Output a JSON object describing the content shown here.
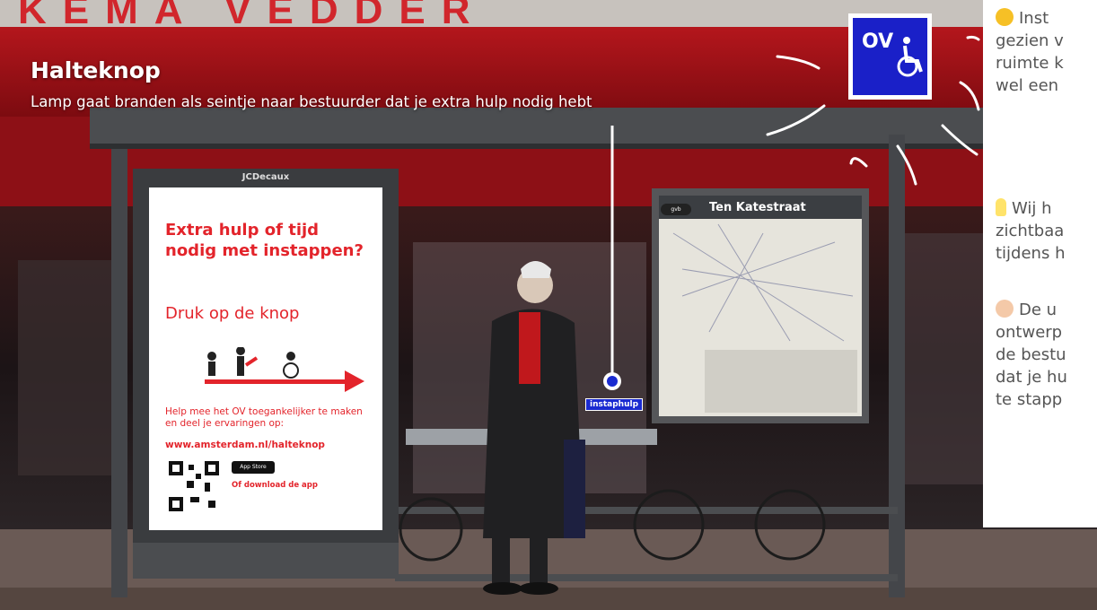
{
  "scene": {
    "heading": "Halteknop",
    "subheading": "Lamp gaat branden als seintje naar bestuurder dat je extra hulp nodig hebt",
    "pointer_label": "instaphulp"
  },
  "ov_sign": {
    "text": "OV",
    "icon": "wheelchair-icon",
    "color": "#1a20c8"
  },
  "poster": {
    "brand": "JCDecaux",
    "heading": "Extra hulp of tijd nodig met instappen?",
    "cta": "Druk op de knop",
    "help_text": "Help mee het OV toegankelijker te maken en deel je ervaringen op:",
    "url": "www.amsterdam.nl/halteknop",
    "appstore": "App Store",
    "download": "Of download de app",
    "accent": "#e3242b"
  },
  "map_board": {
    "title": "Ten Katestraat",
    "badge": "gvb"
  },
  "notes": [
    {
      "emoji": "thinking-face-icon",
      "lines": [
        "Inst",
        "gezien v",
        "ruimte k",
        "wel een"
      ]
    },
    {
      "emoji": "light-bulb-icon",
      "lines": [
        "Wij h",
        "zichtbaa",
        "tijdens h"
      ]
    },
    {
      "emoji": "ok-hand-icon",
      "lines": [
        "De u",
        "ontwerp",
        "de bestu",
        "dat je hu",
        "te stapp"
      ]
    }
  ]
}
